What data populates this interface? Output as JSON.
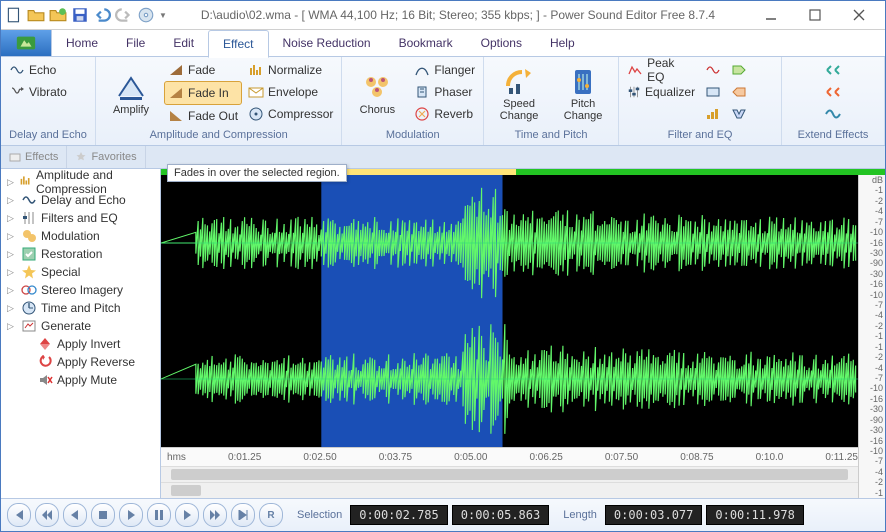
{
  "title": "D:\\audio\\02.wma - [ WMA 44,100 Hz; 16 Bit; Stereo; 355 kbps; ] - Power Sound Editor Free 8.7.4",
  "tabs": {
    "home": "Home",
    "file": "File",
    "edit": "Edit",
    "effect": "Effect",
    "noise": "Noise Reduction",
    "bookmark": "Bookmark",
    "options": "Options",
    "help": "Help"
  },
  "ribbon": {
    "delay_echo": {
      "title": "Delay and Echo",
      "echo": "Echo",
      "vibrato": "Vibrato"
    },
    "amp_comp": {
      "title": "Amplitude and Compression",
      "amplify": "Amplify",
      "fade": "Fade",
      "fade_in": "Fade In",
      "fade_out": "Fade Out",
      "normalize": "Normalize",
      "envelope": "Envelope",
      "compressor": "Compressor"
    },
    "modulation": {
      "title": "Modulation",
      "chorus": "Chorus",
      "flanger": "Flanger",
      "phaser": "Phaser",
      "reverb": "Reverb"
    },
    "time_pitch": {
      "title": "Time and Pitch",
      "speed": "Speed\nChange",
      "pitch": "Pitch\nChange"
    },
    "filter_eq": {
      "title": "Filter and EQ",
      "peak_eq": "Peak EQ",
      "equalizer": "Equalizer"
    },
    "extend": {
      "title": "Extend Effects"
    }
  },
  "tooltip": "Fades in over the selected region.",
  "side_tabs": {
    "effects": "Effects",
    "favorites": "Favorites"
  },
  "tree": [
    {
      "label": "Amplitude and Compression",
      "icon": "amp"
    },
    {
      "label": "Delay and Echo",
      "icon": "echo"
    },
    {
      "label": "Filters and EQ",
      "icon": "eq"
    },
    {
      "label": "Modulation",
      "icon": "mod"
    },
    {
      "label": "Restoration",
      "icon": "rest"
    },
    {
      "label": "Special",
      "icon": "spec"
    },
    {
      "label": "Stereo Imagery",
      "icon": "stereo"
    },
    {
      "label": "Time and Pitch",
      "icon": "tp"
    },
    {
      "label": "Generate",
      "icon": "gen"
    },
    {
      "label": "Apply Invert",
      "icon": "inv",
      "leaf": true
    },
    {
      "label": "Apply Reverse",
      "icon": "rev",
      "leaf": true
    },
    {
      "label": "Apply Mute",
      "icon": "mute",
      "leaf": true
    }
  ],
  "db_labels": [
    "dB",
    "-1",
    "-2",
    "-4",
    "-7",
    "-10",
    "-16",
    "-30",
    "-90",
    "-30",
    "-16",
    "-10",
    "-7",
    "-4",
    "-2",
    "-1"
  ],
  "timeline": {
    "unit": "hms",
    "ticks": [
      "0:01.25",
      "0:02.50",
      "0:03.75",
      "0:05.00",
      "0:06.25",
      "0:07.50",
      "0:08.75",
      "0:10.0",
      "0:11.25"
    ]
  },
  "status": {
    "selection_label": "Selection",
    "length_label": "Length",
    "sel_start": "0:00:02.785",
    "sel_end": "0:00:05.863",
    "len_sel": "0:00:03.077",
    "len_total": "0:00:11.978"
  },
  "selection_pct": {
    "start": 23,
    "end": 49
  }
}
